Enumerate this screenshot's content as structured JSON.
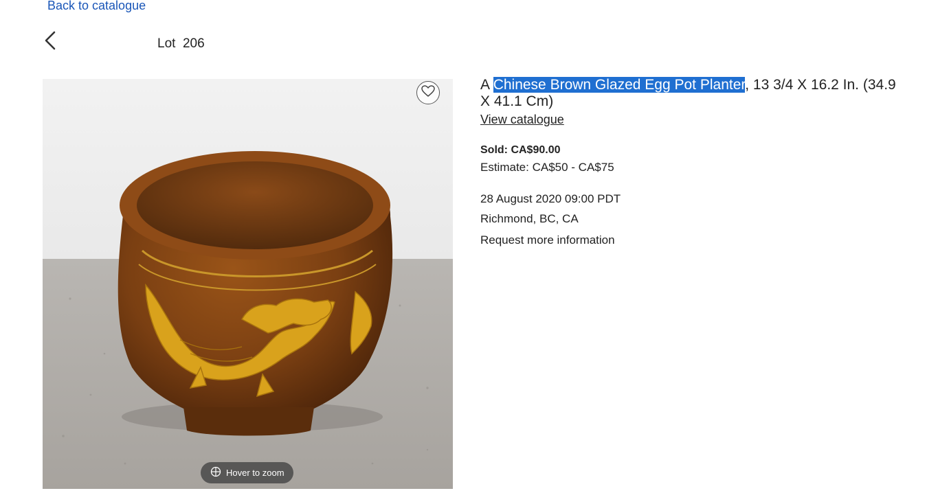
{
  "nav": {
    "back_label": "Back to catalogue",
    "lot_label": "Lot  206"
  },
  "image": {
    "favorite_icon": "heart-icon",
    "zoom_label": "Hover to zoom",
    "zoom_icon": "crosshair-globe-icon"
  },
  "lot": {
    "title_prefix": "A ",
    "title_highlighted": "Chinese Brown Glazed Egg Pot Planter",
    "title_suffix": ", 13 3/4 X 16.2 In. (34.9 X 41.1 Cm)",
    "view_catalogue": "View catalogue",
    "sold": "Sold: CA$90.00",
    "estimate": "Estimate: CA$50 - CA$75",
    "date": "28 August 2020 09:00 PDT",
    "location": "Richmond, BC, CA",
    "request_info": "Request more information"
  },
  "colors": {
    "link": "#1a56b8",
    "selection": "#1f6fd1",
    "pot_glaze": "#7a3f12",
    "dragon": "#d9a21c"
  }
}
